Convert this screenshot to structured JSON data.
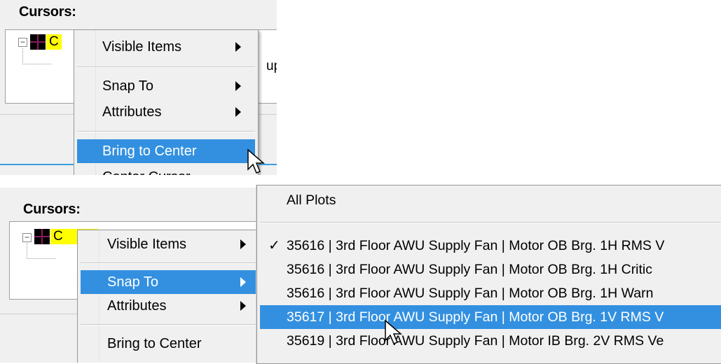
{
  "panel1": {
    "title": "Cursors:",
    "cursor_item_text": "C",
    "peek_text": "up",
    "menu": {
      "items": [
        {
          "label": "Visible Items",
          "submenu": true,
          "selected": false
        },
        {
          "label": "Snap To",
          "submenu": true,
          "selected": false
        },
        {
          "label": "Attributes",
          "submenu": true,
          "selected": false
        },
        {
          "label": "Bring to Center",
          "submenu": false,
          "selected": true
        },
        {
          "label": "Center Cursor",
          "submenu": false,
          "selected": false
        }
      ]
    }
  },
  "panel2": {
    "title": "Cursors:",
    "cursor_item_text": "C",
    "menu": {
      "items": [
        {
          "label": "Visible Items",
          "submenu": true,
          "selected": false
        },
        {
          "label": "Snap To",
          "submenu": true,
          "selected": true
        },
        {
          "label": "Attributes",
          "submenu": true,
          "selected": false
        },
        {
          "label": "Bring to Center",
          "submenu": false,
          "selected": false
        }
      ]
    },
    "submenu": {
      "all_plots": "All Plots",
      "items": [
        {
          "label": "35616 | 3rd Floor AWU Supply Fan | Motor OB Brg. 1H RMS V",
          "checked": true,
          "selected": false
        },
        {
          "label": "35616 | 3rd Floor AWU Supply Fan | Motor OB Brg. 1H Critic",
          "checked": false,
          "selected": false
        },
        {
          "label": "35616 | 3rd Floor AWU Supply Fan | Motor OB Brg. 1H Warn",
          "checked": false,
          "selected": false
        },
        {
          "label": "35617 | 3rd Floor AWU Supply Fan | Motor OB Brg. 1V RMS V",
          "checked": false,
          "selected": true
        },
        {
          "label": "35619 | 3rd Floor AWU Supply Fan | Motor IB Brg. 2V RMS Ve",
          "checked": false,
          "selected": false
        }
      ],
      "check_glyph": "✓"
    }
  },
  "colors": {
    "selection": "#3390e0",
    "menu_bg": "#f0f0f0",
    "highlight": "#ffff00",
    "cursor_cross": "#8b1a5e"
  }
}
